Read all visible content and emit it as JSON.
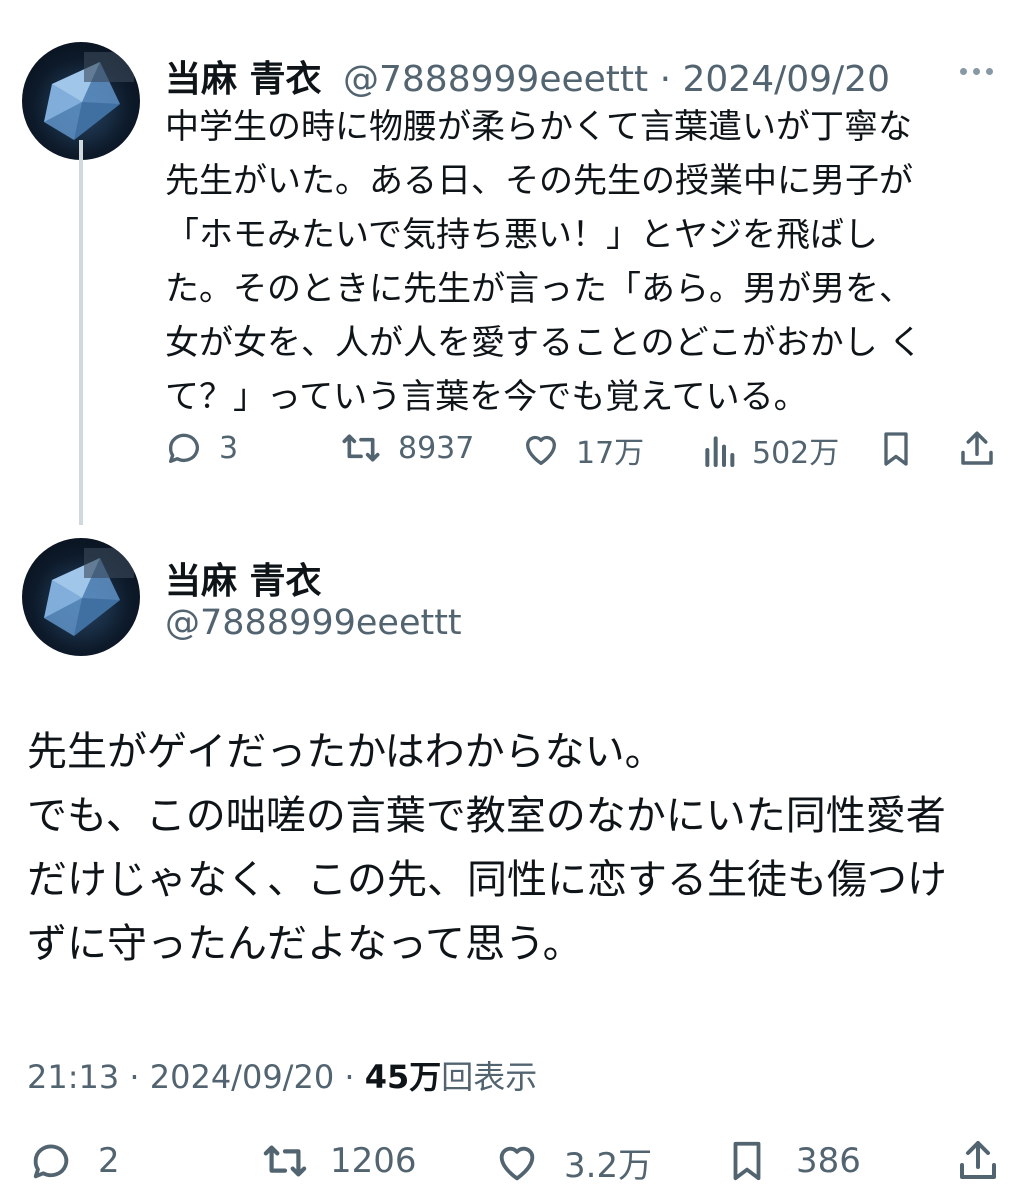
{
  "tweet1": {
    "display_name": "当麻 青衣",
    "handle": "@7888999eeettt",
    "separator": "·",
    "date": "2024/09/20",
    "text_lines": [
      "中学生の時に物腰が柔らかくて言葉遣いが丁寧な",
      "先生がいた。ある日、その先生の授業中に男子が",
      "「ホモみたいで気持ち悪い！」とヤジを飛ばし",
      "た。そのときに先生が言った「あら。男が男を、",
      "女が女を、人が人を愛することのどこがおかし く",
      "て？」っていう言葉を今でも覚えている。"
    ],
    "actions": {
      "replies": "3",
      "retweets": "8937",
      "likes": "17万",
      "views": "502万"
    },
    "icons": [
      "reply-icon",
      "retweet-icon",
      "like-icon",
      "views-icon",
      "bookmark-icon",
      "share-icon",
      "more-icon"
    ]
  },
  "tweet2": {
    "display_name": "当麻 青衣",
    "handle": "@7888999eeettt",
    "text_lines": [
      "先生がゲイだったかはわからない。",
      "でも、この咄嗟の言葉で教室のなかにいた同性愛者",
      "だけじゃなく、この先、同性に恋する生徒も傷つけ",
      "ずに守ったんだよなって思う。"
    ],
    "meta": {
      "time": "21:13",
      "sep1": "·",
      "date": "2024/09/20",
      "sep2": "·",
      "views_count": "45万",
      "views_label": "回表示"
    },
    "actions": {
      "replies": "2",
      "retweets": "1206",
      "likes": "3.2万",
      "bookmarks": "386"
    },
    "icons": [
      "reply-icon",
      "retweet-icon",
      "like-icon",
      "bookmark-icon",
      "share-icon"
    ]
  },
  "colors": {
    "text": "#0f1419",
    "muted": "#536471",
    "thread_line": "#cfd9de",
    "avatar_crystal": "#7fb2e5"
  }
}
